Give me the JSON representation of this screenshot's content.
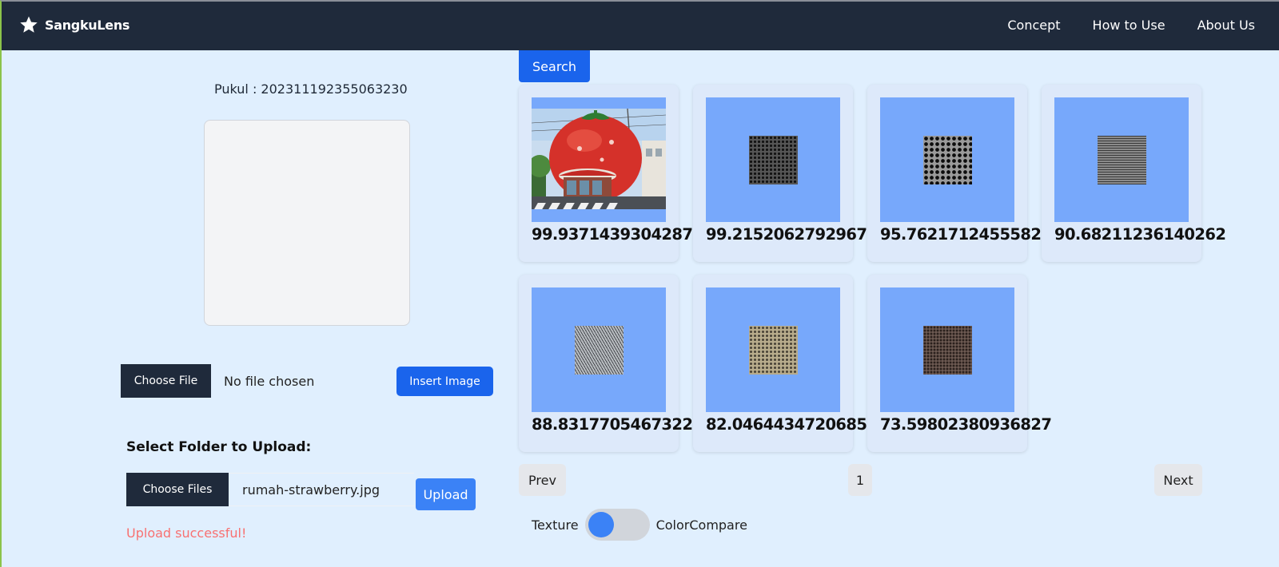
{
  "brand": {
    "name": "SangkuLens"
  },
  "nav": {
    "links": [
      "Concept",
      "How to Use",
      "About Us"
    ]
  },
  "left": {
    "pukul": "Pukul : 202311192355063230",
    "choose_file_label": "Choose File",
    "file_status": "No file chosen",
    "insert_label": "Insert Image",
    "folder_label": "Select Folder to Upload:",
    "choose_files_label": "Choose Files",
    "upload_filename": "rumah-strawberry.jpg",
    "upload_label": "Upload",
    "upload_message": "Upload successful!"
  },
  "search": {
    "label": "Search"
  },
  "results": [
    {
      "score": "99.9371439304287",
      "image": "strawberry-house-photo"
    },
    {
      "score": "99.21520627929678",
      "image": "dark-perforated-metal-texture"
    },
    {
      "score": "95.76217124555826",
      "image": "large-hole-perforated-metal-texture"
    },
    {
      "score": "90.68211236140262",
      "image": "slotted-metal-texture"
    },
    {
      "score": "88.83177054673224",
      "image": "woven-metal-texture"
    },
    {
      "score": "82.04644347206855",
      "image": "beige-perforated-metal-texture"
    },
    {
      "score": "73.59802380936827",
      "image": "brown-perforated-metal-texture"
    }
  ],
  "pagination": {
    "prev": "Prev",
    "page": "1",
    "next": "Next"
  },
  "toggle": {
    "left_label": "Texture",
    "right_label": "ColorCompare"
  },
  "colors": {
    "navbar": "#1f2a3b",
    "accent": "#1a64ec",
    "background": "#e0effe",
    "error": "#f87171"
  }
}
